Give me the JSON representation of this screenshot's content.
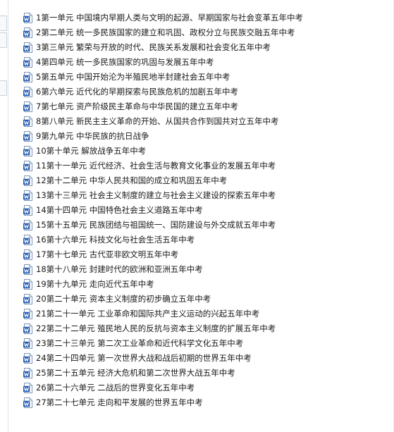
{
  "files": [
    {
      "name": "1第一单元    中国境内早期人类与文明的起源、早期国家与社会变革五年中考",
      "icon": "word-doc-icon"
    },
    {
      "name": "2第二单元    统一多民族国家的建立和巩固、政权分立与民族交融五年中考",
      "icon": "word-doc-icon"
    },
    {
      "name": "3第三单元    繁荣与开放的时代、民族关系发展和社会变化五年中考",
      "icon": "word-doc-icon"
    },
    {
      "name": "4第四单元    统一多民族国家的巩固与发展五年中考",
      "icon": "word-doc-icon"
    },
    {
      "name": "5第五单元    中国开始沦为半殖民地半封建社会五年中考",
      "icon": "word-doc-icon"
    },
    {
      "name": "6第六单元    近代化的早期探索与民族危机的加剧五年中考",
      "icon": "word-doc-icon"
    },
    {
      "name": "7第七单元    资产阶级民主革命与中华民国的建立五年中考",
      "icon": "word-doc-icon"
    },
    {
      "name": "8第八单元    新民主主义革命的开始、从国共合作到国共对立五年中考",
      "icon": "word-doc-icon"
    },
    {
      "name": "9第九单元    中华民族的抗日战争",
      "icon": "word-doc-icon"
    },
    {
      "name": "10第十单元    解放战争五年中考",
      "icon": "word-doc-icon"
    },
    {
      "name": "11第十一单元    近代经济、社会生活与教育文化事业的发展五年中考",
      "icon": "word-doc-icon"
    },
    {
      "name": "12第十二单元    中华人民共和国的成立和巩固五年中考",
      "icon": "word-doc-icon"
    },
    {
      "name": "13第十三单元    社会主义制度的建立与社会主义建设的探索五年中考",
      "icon": "word-doc-icon"
    },
    {
      "name": "14第十四单元    中国特色社会主义道路五年中考",
      "icon": "word-doc-icon"
    },
    {
      "name": "15第十五单元    民族团结与祖国统一、国防建设与外交成就五年中考",
      "icon": "word-doc-icon"
    },
    {
      "name": "16第十六单元    科技文化与社会生活五年中考",
      "icon": "word-doc-icon"
    },
    {
      "name": "17第十七单元    古代亚非欧文明五年中考",
      "icon": "word-doc-icon"
    },
    {
      "name": "18第十八单元    封建时代的欧洲和亚洲五年中考",
      "icon": "word-doc-icon"
    },
    {
      "name": "19第十九单元    走向近代五年中考",
      "icon": "word-doc-icon"
    },
    {
      "name": "20第二十单元    资本主义制度的初步确立五年中考",
      "icon": "word-doc-icon"
    },
    {
      "name": "21第二十一单元    工业革命和国际共产主义运动的兴起五年中考",
      "icon": "word-doc-icon"
    },
    {
      "name": "22第二十二单元    殖民地人民的反抗与资本主义制度的扩展五年中考",
      "icon": "word-doc-icon"
    },
    {
      "name": "23第二十三单元    第二次工业革命和近代科学文化五年中考",
      "icon": "word-doc-icon"
    },
    {
      "name": "24第二十四单元    第一次世界大战和战后初期的世界五年中考",
      "icon": "word-doc-icon"
    },
    {
      "name": "25第二十五单元    经济大危机和第二次世界大战五年中考",
      "icon": "word-doc-icon"
    },
    {
      "name": "26第二十六单元    二战后的世界变化五年中考",
      "icon": "word-doc-icon"
    },
    {
      "name": "27第二十七单元    走向和平发展的世界五年中考",
      "icon": "word-doc-icon"
    }
  ],
  "colors": {
    "icon_blue": "#2b62b8",
    "icon_border": "#1e4f9e",
    "text": "#1a1a1a",
    "background": "#ffffff"
  }
}
